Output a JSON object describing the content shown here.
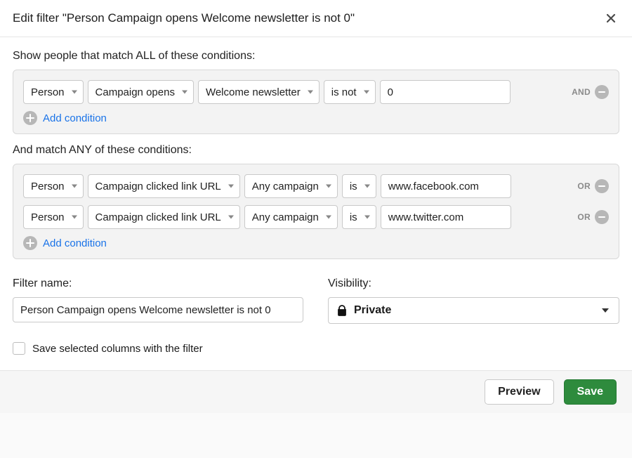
{
  "header": {
    "title": "Edit filter \"Person Campaign opens Welcome newsletter is not 0\""
  },
  "section_all": {
    "label": "Show people that match ALL of these conditions:",
    "logic": "AND",
    "rows": [
      {
        "entity": "Person",
        "field": "Campaign opens",
        "subfield": "Welcome newsletter",
        "op": "is not",
        "value": "0"
      }
    ],
    "add_label": "Add condition"
  },
  "section_any": {
    "label": "And match ANY of these conditions:",
    "logic": "OR",
    "rows": [
      {
        "entity": "Person",
        "field": "Campaign clicked link URL",
        "subfield": "Any campaign",
        "op": "is",
        "value": "www.facebook.com"
      },
      {
        "entity": "Person",
        "field": "Campaign clicked link URL",
        "subfield": "Any campaign",
        "op": "is",
        "value": "www.twitter.com"
      }
    ],
    "add_label": "Add condition"
  },
  "filter_name": {
    "label": "Filter name:",
    "value": "Person Campaign opens Welcome newsletter is not 0"
  },
  "visibility": {
    "label": "Visibility:",
    "value": "Private"
  },
  "save_columns": {
    "label": "Save selected columns with the filter",
    "checked": false
  },
  "footer": {
    "preview": "Preview",
    "save": "Save"
  }
}
